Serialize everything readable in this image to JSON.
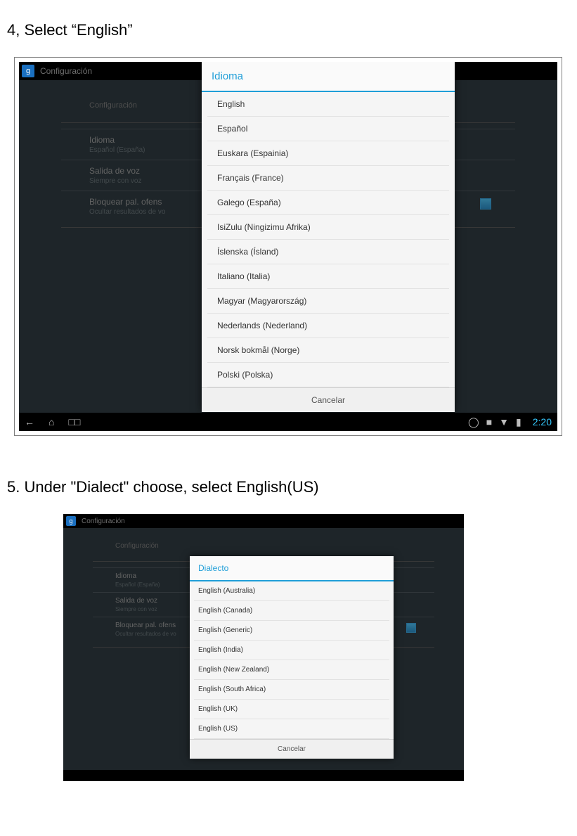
{
  "step4": {
    "instruction": "4, Select “English”",
    "topbar_title": "Configuración",
    "gicon": "g",
    "dim_heading": "Configuración",
    "rows": {
      "idioma": {
        "title": "Idioma",
        "sub": "Español (España)"
      },
      "salida": {
        "title": "Salida de voz",
        "sub": "Siempre con voz"
      },
      "bloquear": {
        "title": "Bloquear pal. ofens",
        "sub": "Ocultar resultados de vo"
      }
    },
    "dialog_title": "Idioma",
    "languages": [
      "English",
      "Español",
      "Euskara (Espainia)",
      "Français (France)",
      "Galego (España)",
      "IsiZulu (Ningizimu Afrika)",
      "Íslenska (Ísland)",
      "Italiano (Italia)",
      "Magyar (Magyarország)",
      "Nederlands (Nederland)",
      "Norsk bokmål (Norge)",
      "Polski (Polska)"
    ],
    "cancel": "Cancelar",
    "clock": "2:20"
  },
  "step5": {
    "instruction": "5. Under \"Dialect\" choose, select English(US)",
    "topbar_title": "Configuración",
    "gicon": "g",
    "dim_heading": "Configuración",
    "rows": {
      "idioma": {
        "title": "Idioma",
        "sub": "Español (España)"
      },
      "salida": {
        "title": "Salida de voz",
        "sub": "Siempre con voz"
      },
      "bloquear": {
        "title": "Bloquear pal. ofens",
        "sub": "Ocultar resultados de vo"
      }
    },
    "dialog_title": "Dialecto",
    "dialects": [
      "English (Australia)",
      "English (Canada)",
      "English (Generic)",
      "English (India)",
      "English (New Zealand)",
      "English (South Africa)",
      "English (UK)",
      "English (US)"
    ],
    "cancel": "Cancelar"
  }
}
